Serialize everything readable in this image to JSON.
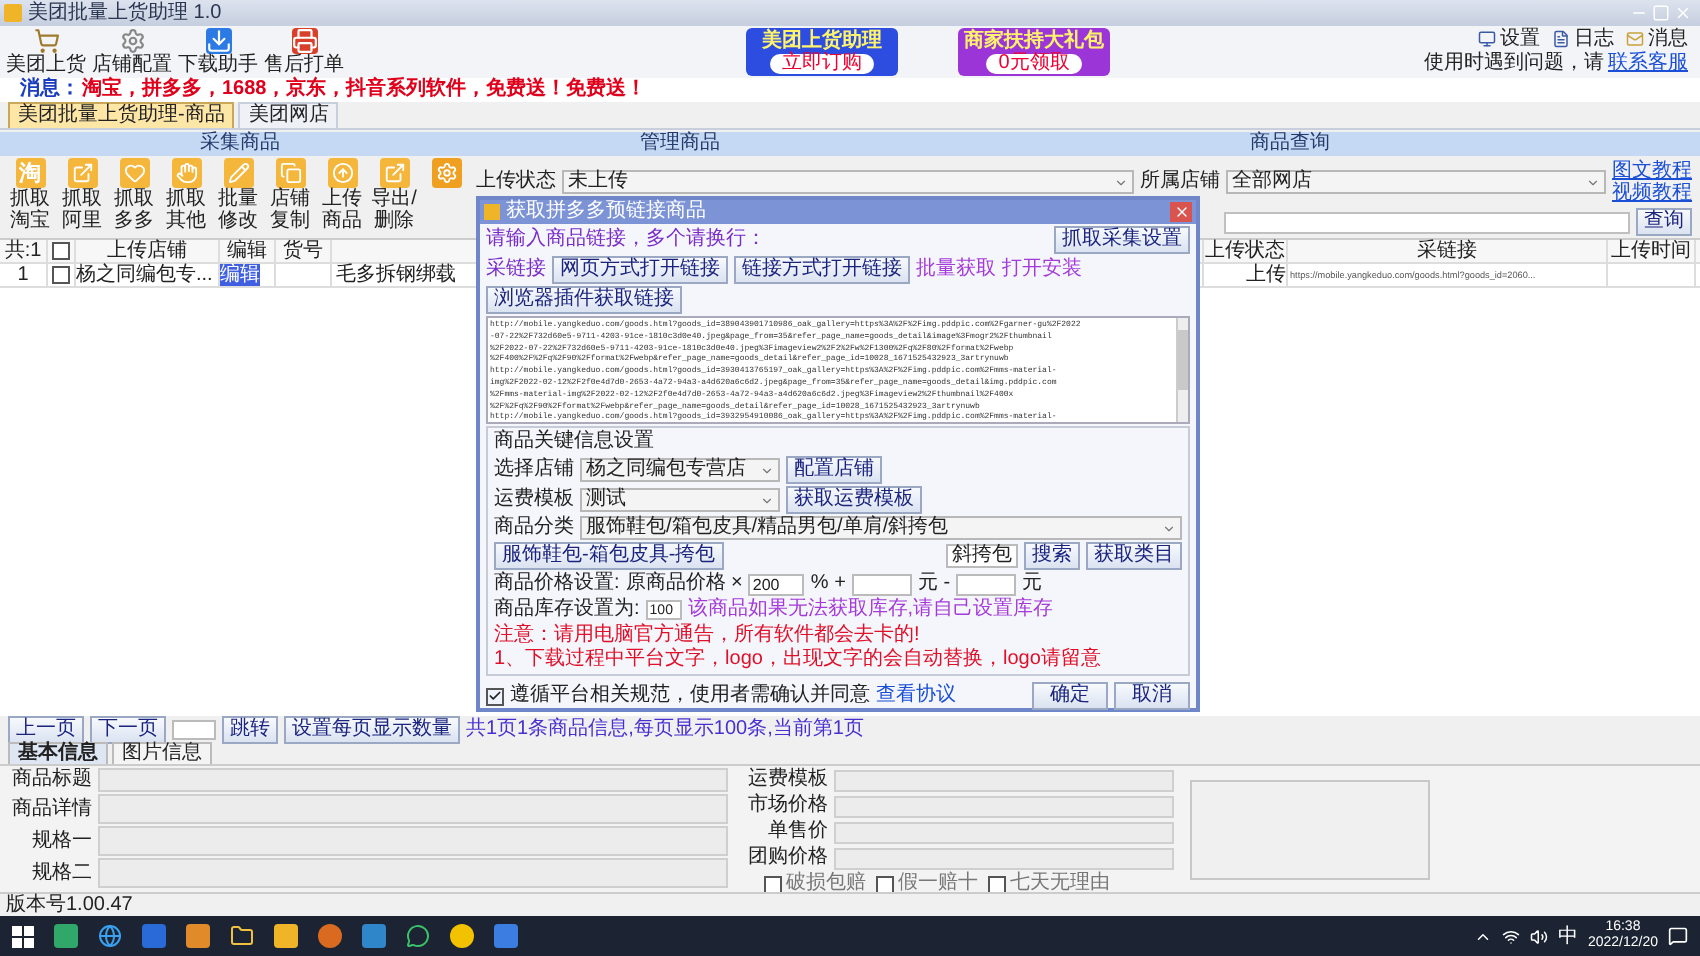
{
  "window": {
    "title": "美团批量上货助理 1.0"
  },
  "toolbar": [
    {
      "label": "美团上货",
      "kind": "cart"
    },
    {
      "label": "店铺配置",
      "kind": "gear"
    },
    {
      "label": "下载助手",
      "kind": "download"
    },
    {
      "label": "售后打单",
      "kind": "print"
    }
  ],
  "promos": [
    {
      "title": "美团上货助理",
      "action": "立即订购",
      "kind": "blue"
    },
    {
      "title": "商家扶持大礼包",
      "action": "0元领取",
      "kind": "purple"
    }
  ],
  "top_links": [
    "设置",
    "日志",
    "消息"
  ],
  "help": {
    "text": "使用时遇到问题，请",
    "link": "联系客服"
  },
  "message": {
    "label": "消息：",
    "text": "淘宝，拼多多，1688，京东，抖音系列软件，免费送！免费送！"
  },
  "tabs": [
    {
      "label": "美团批量上货助理-商品",
      "selected": true
    },
    {
      "label": "美团网店",
      "selected": false
    }
  ],
  "sections": [
    "采集商品",
    "管理商品",
    "商品查询"
  ],
  "actions": [
    {
      "label": "抓取淘宝",
      "kind": "tao",
      "glyph": "淘"
    },
    {
      "label": "抓取阿里",
      "kind": "ali"
    },
    {
      "label": "抓取多多",
      "kind": "heart"
    },
    {
      "label": "抓取其他",
      "kind": "grab"
    },
    {
      "label": "批量修改",
      "kind": "pencil"
    },
    {
      "label": "店铺复制",
      "kind": "copy"
    },
    {
      "label": "上传商品",
      "kind": "upload"
    },
    {
      "label": "导出/删除",
      "kind": "export"
    },
    {
      "kind": "gear"
    }
  ],
  "filters": {
    "status_label": "上传状态",
    "status": "未上传",
    "shop_label": "所属店铺",
    "shop": "全部网店",
    "links": [
      "图文教程",
      "视频教程"
    ],
    "query": "查询"
  },
  "table": {
    "count": "共:1",
    "all_checked": false,
    "columns": [
      "上传店铺",
      "编辑",
      "货号"
    ],
    "rows": [
      {
        "index": "1",
        "checked": false,
        "shop": "杨之同编包专...",
        "edit": "编辑",
        "sku": "",
        "title": "毛多拆钢绑载"
      }
    ]
  },
  "table_right": {
    "columns": [
      "上传状态",
      "采链接",
      "上传时间"
    ],
    "rows": [
      [
        "上传",
        "https://mobile.yangkeduo.com/goods.html?goods_id=2060...",
        ""
      ]
    ]
  },
  "pager": {
    "prev": "上一页",
    "next": "下一页",
    "jump": "跳转",
    "page_size": "设置每页显示数量",
    "info": "共1页1条商品信息,每页显示100条,当前第1页"
  },
  "detail_tabs": [
    {
      "label": "基本信息",
      "selected": true
    },
    {
      "label": "图片信息",
      "selected": false
    }
  ],
  "form": {
    "left": [
      "商品标题",
      "商品详情",
      "规格一",
      "规格二"
    ],
    "right": [
      "运费模板",
      "市场价格",
      "单售价",
      "团购价格"
    ],
    "checks": [
      {
        "label": "破损包赔",
        "checked": false
      },
      {
        "label": "假一赔十",
        "checked": false
      },
      {
        "label": "七天无理由",
        "checked": false
      }
    ]
  },
  "status_bar": "版本号1.00.47",
  "dialog": {
    "title": "获取拼多多预链接商品",
    "prompt": "请输入商品链接，多个请换行：",
    "settings_button": "抓取采集设置",
    "link_label": "采链接",
    "open_buttons": [
      "网页方式打开链接",
      "链接方式打开链接"
    ],
    "batch_text": "批量获取 打开安装",
    "plugin_button": "浏览器插件获取链接",
    "urls": [
      "http://mobile.yangkeduo.com/goods.html?goods_id=389043901710986_oak_gallery=https%3A%2F%2Fimg.pddpic.com%2Fgarner-gu%2F2022",
      "-07-22%2F732d60e5-9711-4203-91ce-1810c3d0e40.jpeg&page_from=35&refer_page_name=goods_detail&image%3Fmogr2%2Fthumbnail",
      "%2F2022-07-22%2F732d60e5-9711-4203-91ce-1810c3d0e40.jpeg%3Fimageview2%2F2%2Fw%2F1300%2Fq%2F80%2Fformat%2Fwebp",
      "%2F400%2F%2Fq%2F90%2Fformat%2Fwebp&refer_page_name=goods_detail&refer_page_id=10028_1671525432923_3artrynuwb",
      "http://mobile.yangkeduo.com/goods.html?goods_id=3930413765197_oak_gallery=https%3A%2F%2Fimg.pddpic.com%2Fmms-material-",
      "img%2F2022-02-12%2F2f0e4d7d0-2653-4a72-94a3-a4d620a6c6d2.jpeg&page_from=35&refer_page_name=goods_detail&img.pddpic.com",
      "%2Fmms-material-img%2F2022-02-12%2F2f0e4d7d0-2653-4a72-94a3-a4d620a6c6d2.jpeg%3Fimageview2%2Fthumbnail%2F400x",
      "%2F%2Fq%2F90%2Fformat%2Fwebp&refer_page_name=goods_detail&refer_page_id=10028_1671525432923_3artrynuwb",
      "http://mobile.yangkeduo.com/goods.html?goods_id=3932954910086_oak_gallery=https%3A%2F%2Fimg.pddpic.com%2Fmms-material-"
    ],
    "group_title": "商品关键信息设置",
    "shop_label": "选择店铺",
    "shop": "杨之同编包专营店",
    "shop_button": "配置店铺",
    "freight_label": "运费模板",
    "freight": "测试",
    "freight_button": "获取运费模板",
    "category_label": "商品分类",
    "category": "服饰鞋包/箱包皮具/精品男包/单肩/斜挎包",
    "category_search": "斜挎包",
    "search_button": "搜索",
    "category_button": "获取类目",
    "category_path": "服饰鞋包-箱包皮具-挎包",
    "price_label": "商品价格设置:",
    "price_base": "原商品价格 ×",
    "price_percent": "200",
    "percent_plus": "% +",
    "yuan_minus": "元 -",
    "yuan": "元",
    "stock_label": "商品库存设置为:",
    "stock": "100",
    "stock_hint": "该商品如果无法获取库存,请自己设置库存",
    "notes": [
      "注意：请用电脑官方通告，所有软件都会去卡的!",
      "1、下载过程中平台文字，logo，出现文字的会自动替换，logo请留意"
    ],
    "agree": {
      "checked": true,
      "text": "遵循平台相关规范，使用者需确认并同意",
      "link": "查看协议"
    },
    "ok": "确定",
    "cancel": "取消"
  },
  "taskbar": {
    "ime": "中",
    "time": "16:38",
    "date": "2022/12/20"
  }
}
